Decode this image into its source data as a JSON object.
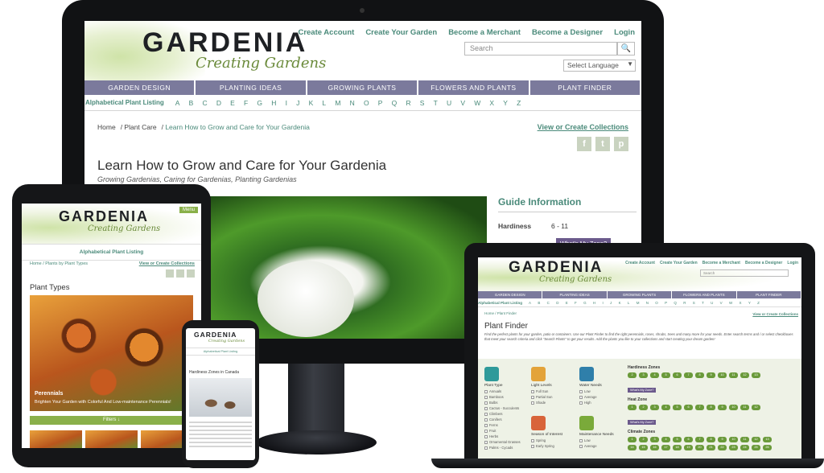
{
  "desktop": {
    "logo": "GARDENIA",
    "tagline": "Creating Gardens",
    "top_links": [
      "Create Account",
      "Create Your Garden",
      "Become a Merchant",
      "Become a Designer",
      "Login"
    ],
    "search_placeholder": "Search",
    "language_label": "Select Language",
    "nav": [
      "GARDEN DESIGN",
      "PLANTING IDEAS",
      "GROWING PLANTS",
      "FLOWERS AND PLANTS",
      "PLANT FINDER"
    ],
    "alpha_label": "Alphabetical Plant Listing",
    "letters": [
      "A",
      "B",
      "C",
      "D",
      "E",
      "F",
      "G",
      "H",
      "I",
      "J",
      "K",
      "L",
      "M",
      "N",
      "O",
      "P",
      "Q",
      "R",
      "S",
      "T",
      "U",
      "V",
      "W",
      "X",
      "Y",
      "Z"
    ],
    "breadcrumb": [
      "Home",
      "Plant Care",
      "Learn How to Grow and Care for Your Gardenia"
    ],
    "collections_link": "View or Create Collections",
    "title": "Learn How to Grow and Care for Your Gardenia",
    "subtitle": "Growing Gardenias, Caring for Gardenias, Planting Gardenias",
    "guide_title": "Guide Information",
    "hardiness_label": "Hardiness",
    "hardiness_value": "6 - 11",
    "zone_button": "What's My Zone?"
  },
  "tablet": {
    "logo": "GARDENIA",
    "tagline": "Creating Gardens",
    "menu": "Menu",
    "alpha_label": "Alphabetical Plant Listing",
    "breadcrumb": "Home / Plants by Plant Types",
    "collections_link": "View or Create Collections",
    "title": "Plant Types",
    "caption_title": "Perennials",
    "caption_text": "Brighten Your Garden with Colorful And Low-maintenance Perennials!",
    "filter_button": "Filters ↓"
  },
  "phone": {
    "logo": "GARDENIA",
    "tagline": "Creating Gardens",
    "alpha_label": "Alphabetical Plant Listing",
    "title": "Hardiness Zones in Canada"
  },
  "laptop": {
    "logo": "GARDENIA",
    "tagline": "Creating Gardens",
    "top_links": [
      "Create Account",
      "Create Your Garden",
      "Become a Merchant",
      "Become a Designer",
      "Login"
    ],
    "search_placeholder": "Search",
    "nav": [
      "GARDEN DESIGN",
      "PLANTING IDEAS",
      "GROWING PLANTS",
      "FLOWERS AND PLANTS",
      "PLANT FINDER"
    ],
    "alpha_label": "Alphabetical Plant Listing",
    "breadcrumb": "Home / Plant Finder",
    "collections_link": "View or Create Collections",
    "title": "Plant Finder",
    "intro": "Find the perfect plants for your garden, patio or containers. Use our Plant Finder to find the right perennials, roses, shrubs, trees and many more for your needs. Enter search terms and / or select checkboxes that meet your search criteria and click \"Search Plants\" to get your results. Add the plants you like to your collections and start creating your dream garden!",
    "plant_type": {
      "title": "Plant Type",
      "options": [
        "Annuals",
        "Bamboos",
        "Bulbs",
        "Cactus - Succulents",
        "Climbers",
        "Conifers",
        "Ferns",
        "Fruit",
        "Herbs",
        "Ornamental Grasses",
        "Palms - Cycads"
      ]
    },
    "light": {
      "title": "Light Levels",
      "options": [
        "Full Sun",
        "Partial Sun",
        "Shade"
      ]
    },
    "water": {
      "title": "Water Needs",
      "options": [
        "Low",
        "Average",
        "High"
      ]
    },
    "season": {
      "title": "Season of Interest",
      "options": [
        "Spring",
        "Early Spring"
      ]
    },
    "maintenance": {
      "title": "Maintenance Needs",
      "options": [
        "Low",
        "Average"
      ]
    },
    "hardiness_title": "Hardiness Zones",
    "heat_title": "Heat Zone",
    "climate_title": "Climate Zones",
    "zone_button": "What's My Zone?",
    "hardiness_zones": [
      "2",
      "3",
      "4",
      "5",
      "6",
      "7",
      "8",
      "9",
      "10",
      "11",
      "12",
      "13"
    ],
    "heat_zones": [
      "1",
      "2",
      "3",
      "4",
      "5",
      "6",
      "7",
      "8",
      "9",
      "10",
      "11",
      "12"
    ],
    "climate_zones": [
      "1",
      "2",
      "3",
      "4",
      "5",
      "6",
      "7",
      "8",
      "9",
      "10",
      "11",
      "12",
      "13"
    ],
    "climate_zones_2": [
      "14",
      "15",
      "16",
      "17",
      "18",
      "19",
      "20",
      "21",
      "22",
      "23",
      "24",
      "25",
      "26"
    ]
  },
  "colors": {
    "accent": "#4a8a7a",
    "nav": "#7b7a9c",
    "button": "#6b5a8c",
    "green": "#8ab04a"
  }
}
